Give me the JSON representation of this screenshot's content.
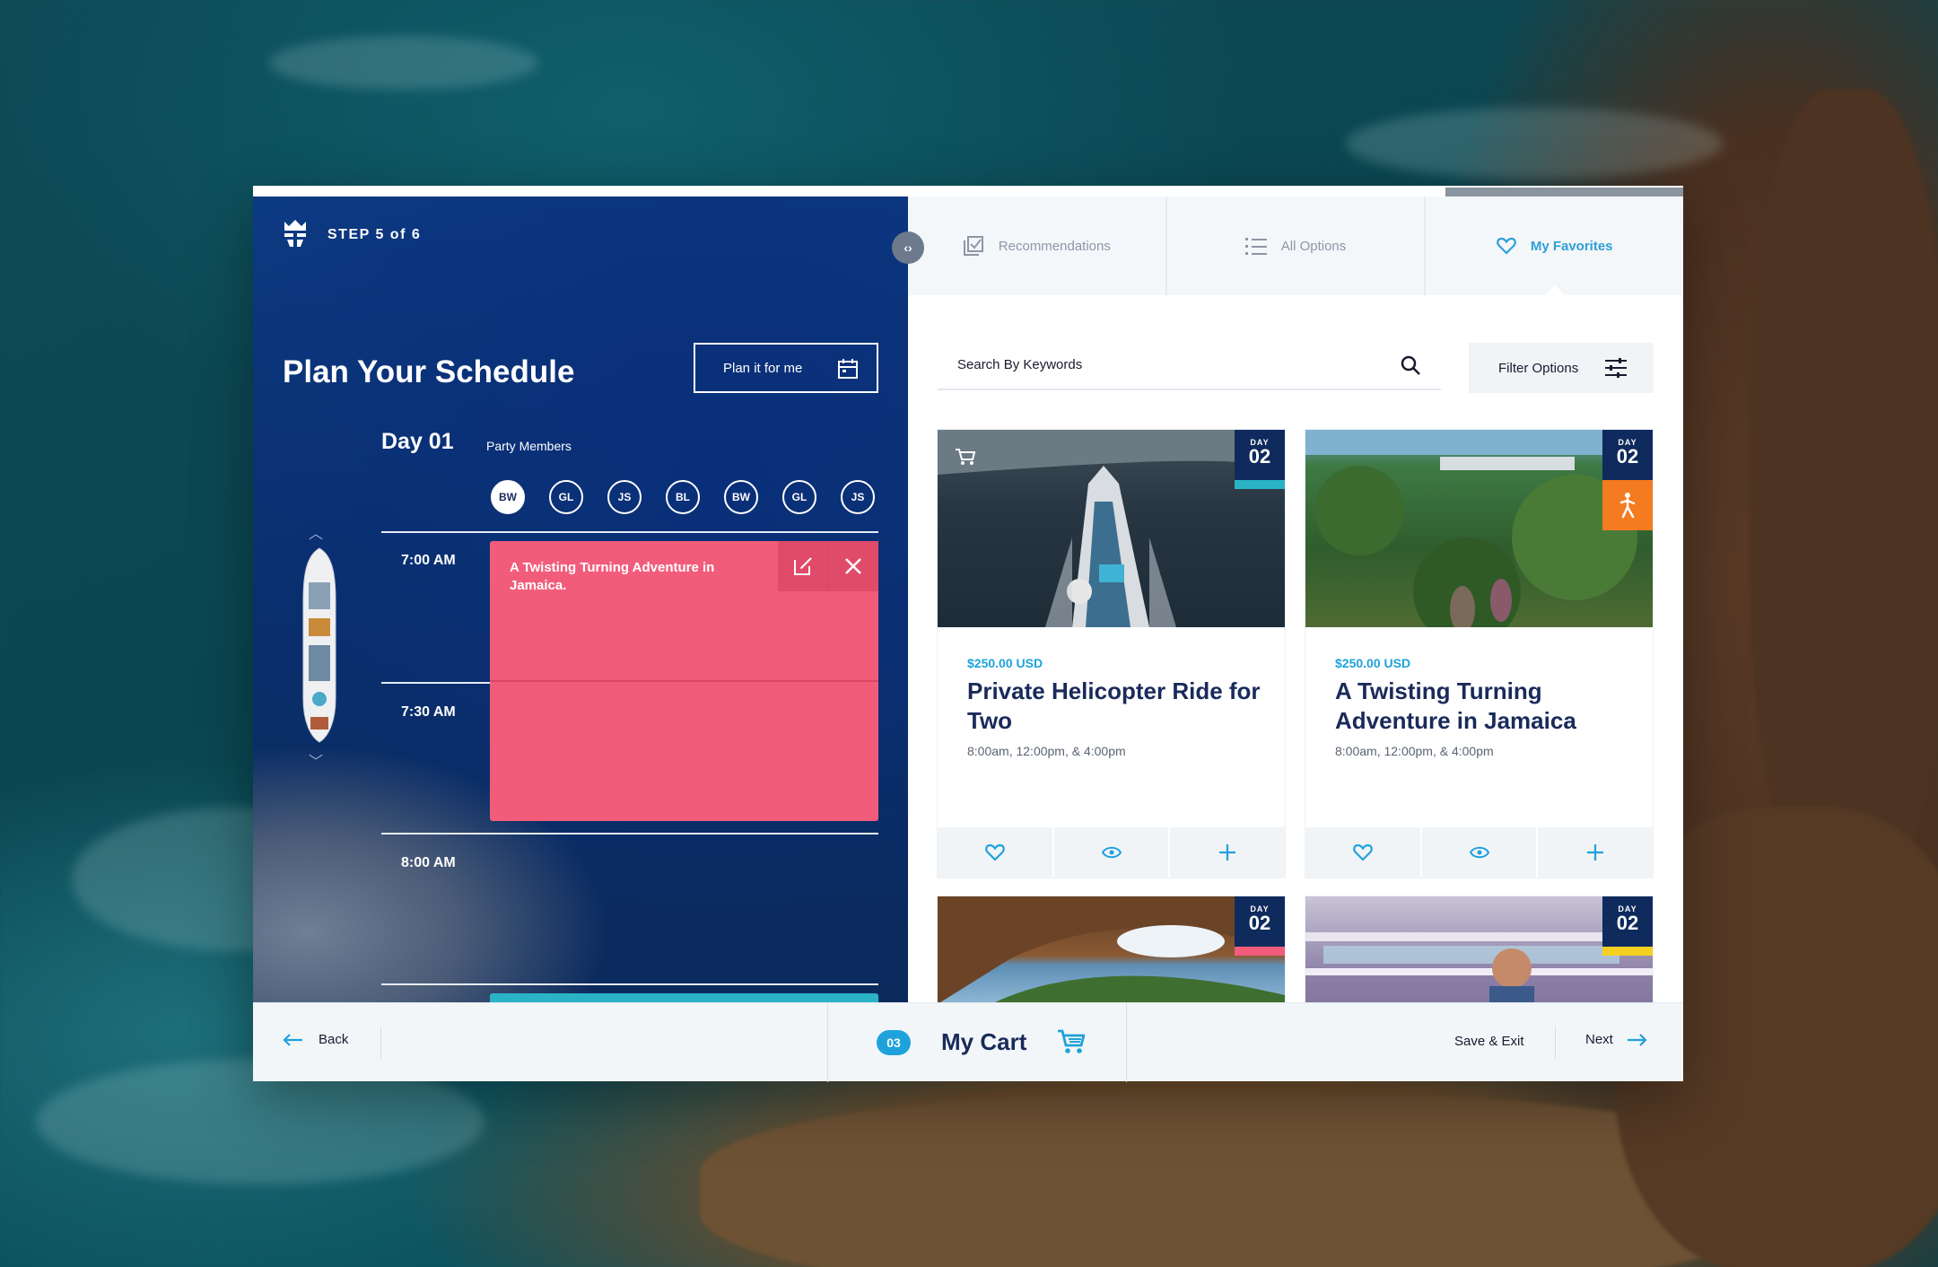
{
  "app": {
    "step_label": "STEP 5 of 6"
  },
  "schedule": {
    "title": "Plan Your Schedule",
    "plan_button": "Plan it for me",
    "day_label": "Day 01",
    "party_label": "Party Members",
    "party_members": [
      "BW",
      "GL",
      "JS",
      "BL",
      "BW",
      "GL",
      "JS"
    ],
    "times": [
      "7:00 AM",
      "7:30 AM",
      "8:00 AM"
    ],
    "event": {
      "title": "A Twisting Turning Adventure in Jamaica."
    }
  },
  "tabs": [
    {
      "label": "Recommendations",
      "icon": "checkbox-icon"
    },
    {
      "label": "All Options",
      "icon": "list-icon"
    },
    {
      "label": "My Favorites",
      "icon": "heart-icon",
      "active": true
    }
  ],
  "search": {
    "placeholder": "Search By Keywords"
  },
  "filter": {
    "label": "Filter Options"
  },
  "cards": [
    {
      "day_word": "DAY",
      "day": "02",
      "price": "$250.00 USD",
      "title": "Private Helicopter Ride for Two",
      "times": "8:00am, 12:00pm, & 4:00pm",
      "stripe_color": "#2ab3c6",
      "cart_badge": true
    },
    {
      "day_word": "DAY",
      "day": "02",
      "price": "$250.00 USD",
      "title": "A Twisting Turning Adventure in Jamaica",
      "times": "8:00am, 12:00pm, & 4:00pm",
      "activity_badge_color": "#f47b20"
    },
    {
      "day_word": "DAY",
      "day": "02",
      "stripe_color": "#f25c7b"
    },
    {
      "day_word": "DAY",
      "day": "02",
      "stripe_color": "#f5d020"
    }
  ],
  "footer": {
    "back": "Back",
    "cart_count": "03",
    "cart_label": "My Cart",
    "save_exit": "Save & Exit",
    "next": "Next"
  },
  "colors": {
    "accent": "#1fa2db",
    "navy": "#1a2a5a",
    "event": "#f25c7b"
  }
}
